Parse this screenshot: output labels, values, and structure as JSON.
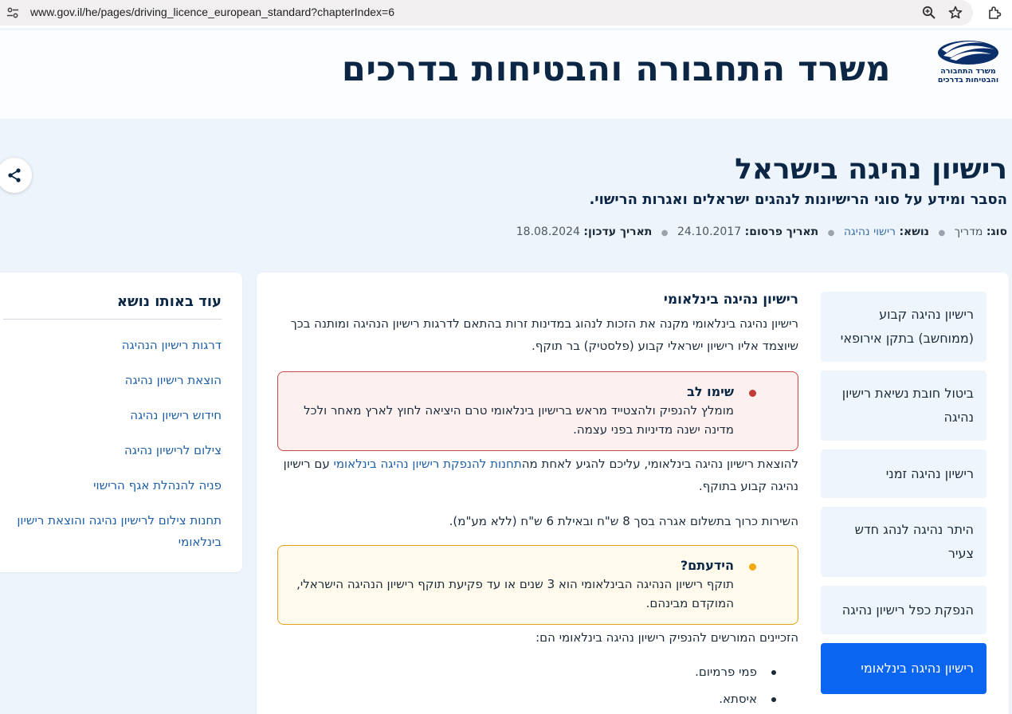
{
  "browser": {
    "url": "www.gov.il/he/pages/driving_licence_european_standard?chapterIndex=6",
    "icons": [
      "tune-icon",
      "zoom-icon",
      "star-icon",
      "extensions-icon"
    ]
  },
  "site": {
    "title": "משרד התחבורה והבטיחות בדרכים",
    "logo_line1": "משרד התחבורה",
    "logo_line2": "והבטיחות בדרכים"
  },
  "page": {
    "title": "רישיון נהיגה בישראל",
    "subtitle": "הסבר ומידע על סוגי הרישיונות לנהגים ישראלים ואגרות הרישוי.",
    "meta": {
      "type_label": "סוג:",
      "type_value": "מדריך",
      "topic_label": "נושא:",
      "topic_value": "רישוי נהיגה",
      "published_label": "תאריך פרסום:",
      "published_value": "24.10.2017",
      "updated_label": "תאריך עדכון:",
      "updated_value": "18.08.2024"
    }
  },
  "more_on_topic": {
    "title": "עוד באותו נושא",
    "links": [
      "דרגות רישיון הנהיגה",
      "הוצאת רישיון נהיגה",
      "חידוש רישיון נהיגה",
      "צילום לרישיון נהיגה",
      "פניה להנהלת אגף הרישוי",
      "תחנות צילום לרישיון נהיגה והוצאת רישיון בינלאומי"
    ]
  },
  "chapters": [
    {
      "label": "רישיון נהיגה קבוע (ממוחשב) בתקן אירופאי",
      "active": false
    },
    {
      "label": "ביטול חובת נשיאת רישיון נהיגה",
      "active": false
    },
    {
      "label": "רישיון נהיגה זמני",
      "active": false
    },
    {
      "label": "היתר נהיגה לנהג חדש צעיר",
      "active": false
    },
    {
      "label": "הנפקת כפל רישיון נהיגה",
      "active": false
    },
    {
      "label": "רישיון נהיגה בינלאומי",
      "active": true
    }
  ],
  "content": {
    "section_title": "רישיון נהיגה בינלאומי",
    "intro": "רישיון נהיגה בינלאומי מקנה את הזכות לנהוג במדינות זרות בהתאם לדרגות רישיון הנהיגה ומותנה בכך שיוצמד אליו רישיון ישראלי קבוע (פלסטיק) בר תוקף.",
    "alert_attention": {
      "title": "שימו לב",
      "body": "מומלץ להנפיק ולהצטייד מראש ברישיון בינלאומי טרם היציאה לחוץ לארץ מאחר ולכל מדינה ישנה מדיניות בפני עצמה."
    },
    "issue_text_before": "להוצאת רישיון נהיגה בינלאומי, עליכם להגיע לאחת מה",
    "issue_link": "תחנות להנפקת רישיון נהיגה בינלאומי",
    "issue_text_after": " עם רישיון נהיגה קבוע בתוקף.",
    "fee_text": "השירות כרוך בתשלום אגרה בסך 8 ש\"ח ובאילת 6 ש\"ח (ללא מע\"מ).",
    "alert_didyouknow": {
      "title": "הידעתם?",
      "body": "תוקף רישיון הנהיגה הבינלאומי הוא 3 שנים או עד פקיעת תוקף רישיון הנהיגה הישראלי, המוקדם מבינהם."
    },
    "issuers_intro": "הזכיינים המורשים להנפיק רישיון נהיגה בינלאומי הם:",
    "issuers": [
      "פמי פרמיום.",
      "איסתא."
    ]
  },
  "colors": {
    "navy": "#0b2745",
    "link": "#1f5fa8",
    "active_chapter": "#0a65f0",
    "attention_border": "#cc4a47",
    "didyouknow_border": "#e2a21c"
  }
}
